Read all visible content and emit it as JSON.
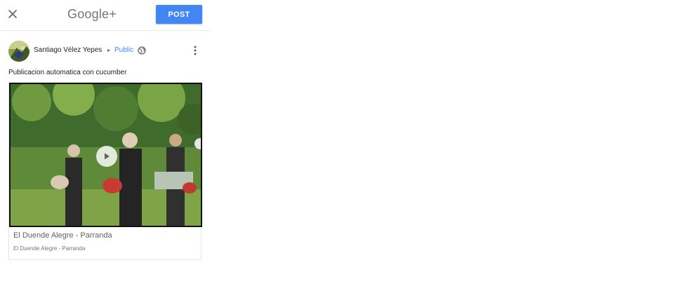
{
  "header": {
    "brand": "Google+",
    "post_label": "POST",
    "close_icon": "close-icon",
    "post_button_color": "#4285f4"
  },
  "author": {
    "name": "Santiago Vélez Yepes",
    "audience": "Public",
    "audience_color": "#4285f4",
    "audience_icon": "globe-icon",
    "more_icon": "more-vert-icon"
  },
  "post": {
    "text": "Publicacion automatica con cucumber"
  },
  "link_card": {
    "title": "El Duende Alegre - Parranda",
    "subtitle": "El Duende Alegre - Parranda",
    "play_icon": "play-icon"
  }
}
